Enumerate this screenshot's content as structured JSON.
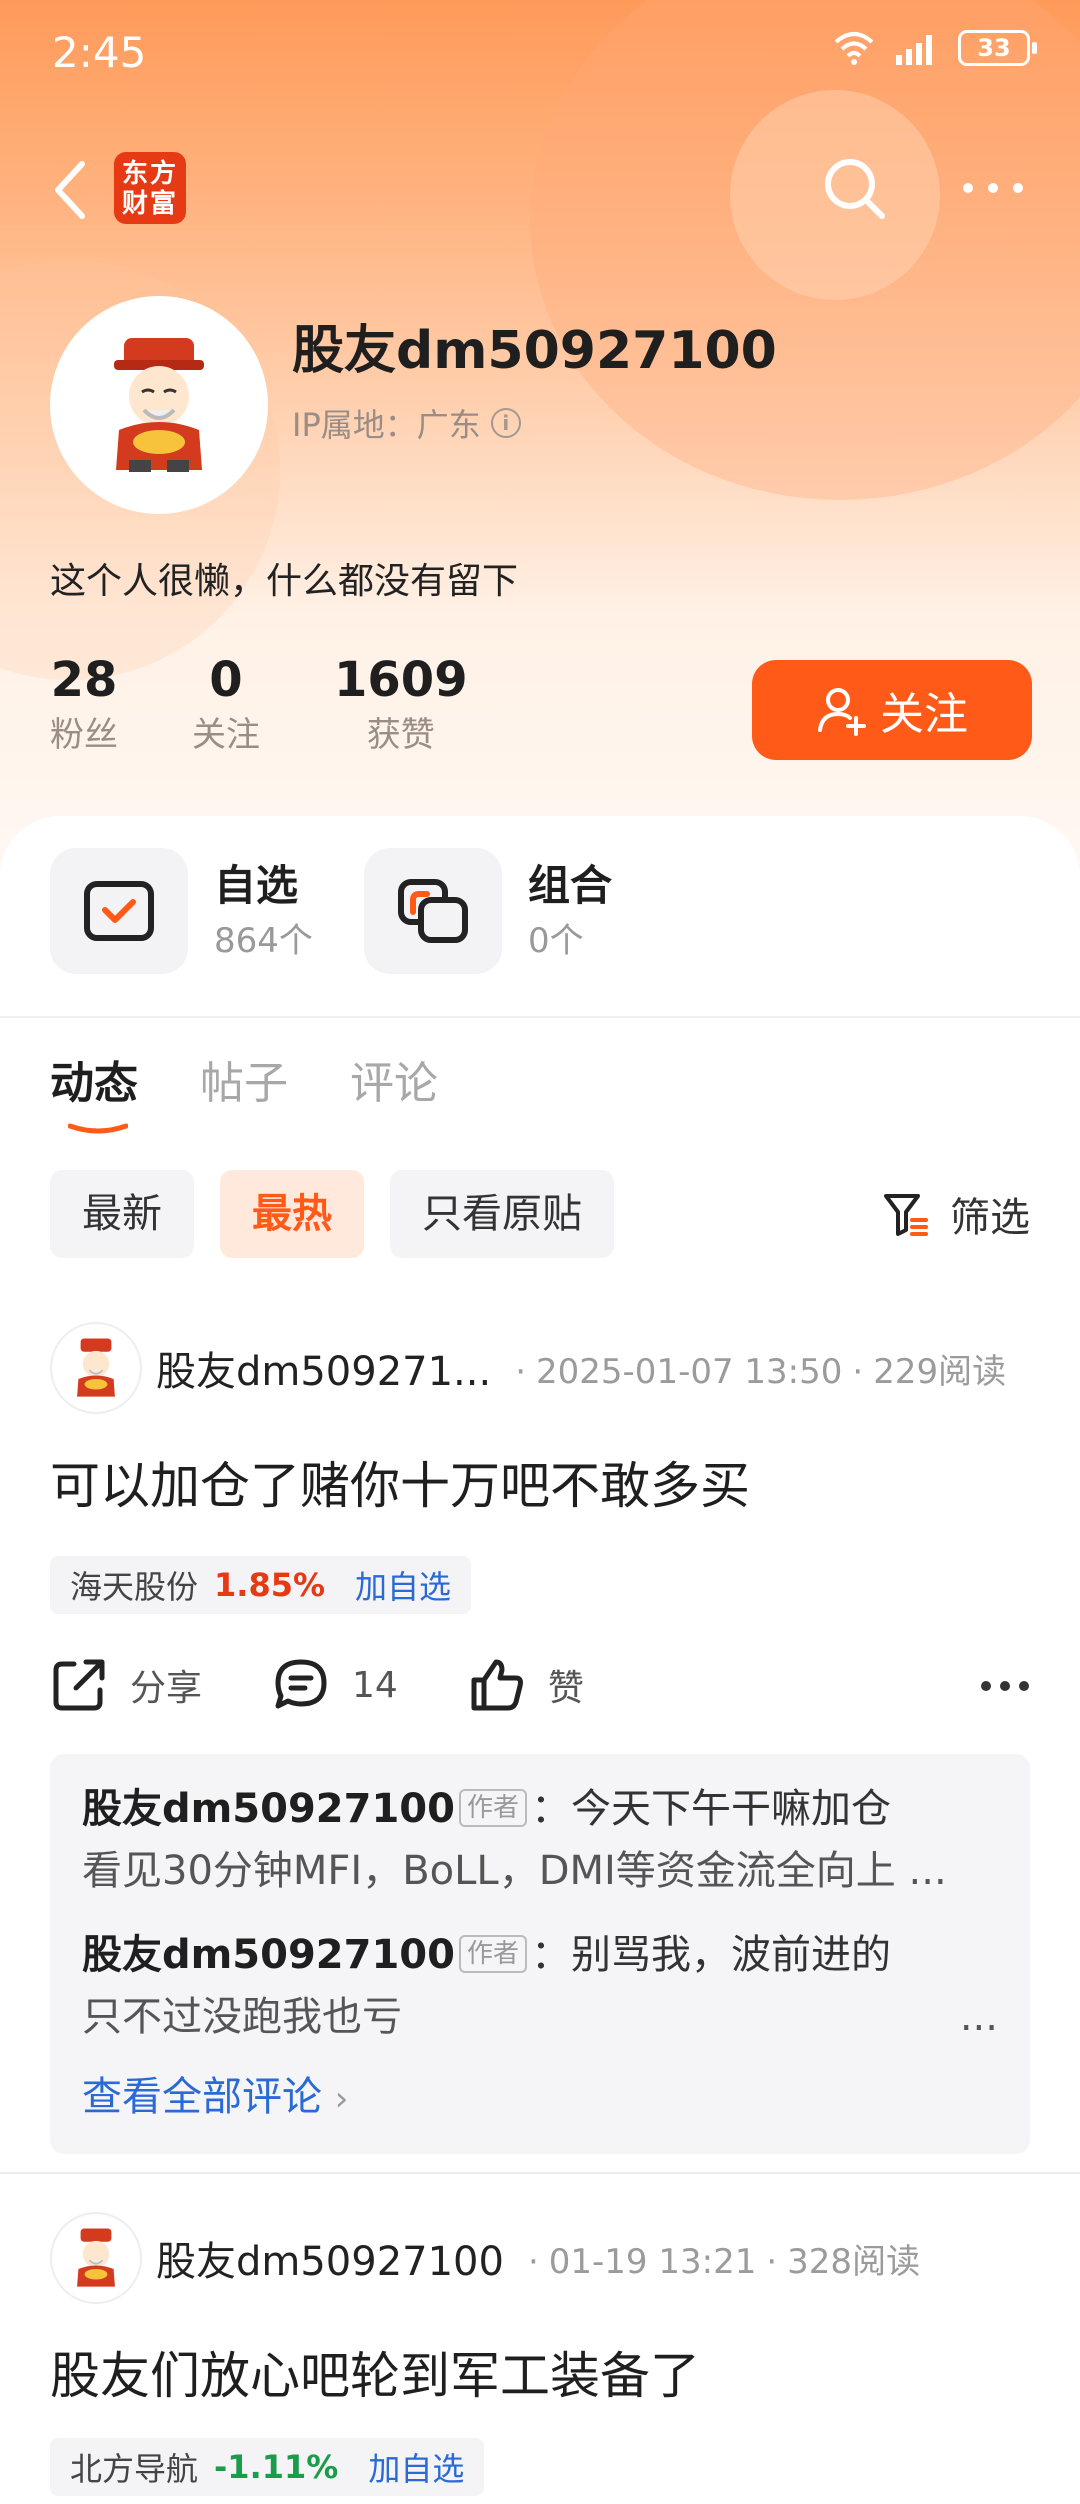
{
  "status_bar": {
    "time": "2:45",
    "battery": "33"
  },
  "nav": {
    "logo_line1": "东方",
    "logo_line2": "财富"
  },
  "profile": {
    "username": "股友dm50927100",
    "ip_label": "IP属地：广东",
    "bio": "这个人很懒，什么都没有留下",
    "stats": [
      {
        "value": "28",
        "label": "粉丝"
      },
      {
        "value": "0",
        "label": "关注"
      },
      {
        "value": "1609",
        "label": "获赞"
      }
    ],
    "follow_label": "关注"
  },
  "watchlists": [
    {
      "title": "自选",
      "count": "864个"
    },
    {
      "title": "组合",
      "count": "0个"
    }
  ],
  "tabs": [
    "动态",
    "帖子",
    "评论"
  ],
  "filters": {
    "chips": [
      "最新",
      "最热",
      "只看原贴"
    ],
    "filter_label": "筛选"
  },
  "colors": {
    "accent": "#ff5a17",
    "up": "#e63a14",
    "down": "#1a9c4a",
    "link": "#2a6ad6"
  },
  "posts": [
    {
      "author": "股友dm509271...",
      "time": "2025-01-07 13:50",
      "reads": "229阅读",
      "title": "可以加仓了赌你十万吧不敢多买",
      "stock": {
        "name": "海天股份",
        "change": "1.85%",
        "add": "加自选"
      },
      "actions": {
        "share": "分享",
        "comments": "14",
        "like": "赞"
      },
      "comments": [
        {
          "author": "股友dm50927100",
          "tag": "作者",
          "line1": "：今天下午干嘛加仓",
          "line2": "看见30分钟MFI，BoLL，DMI等资金流全向上 ..."
        },
        {
          "author": "股友dm50927100",
          "tag": "作者",
          "line1": "：别骂我，波前进的",
          "line2": "只不过没跑我也亏"
        }
      ],
      "view_all": "查看全部评论"
    },
    {
      "author": "股友dm50927100",
      "time": "01-19 13:21",
      "reads": "328阅读",
      "title": "股友们放心吧轮到军工装备了",
      "stock": {
        "name": "北方导航",
        "change": "-1.11%",
        "add": "加自选"
      }
    }
  ]
}
